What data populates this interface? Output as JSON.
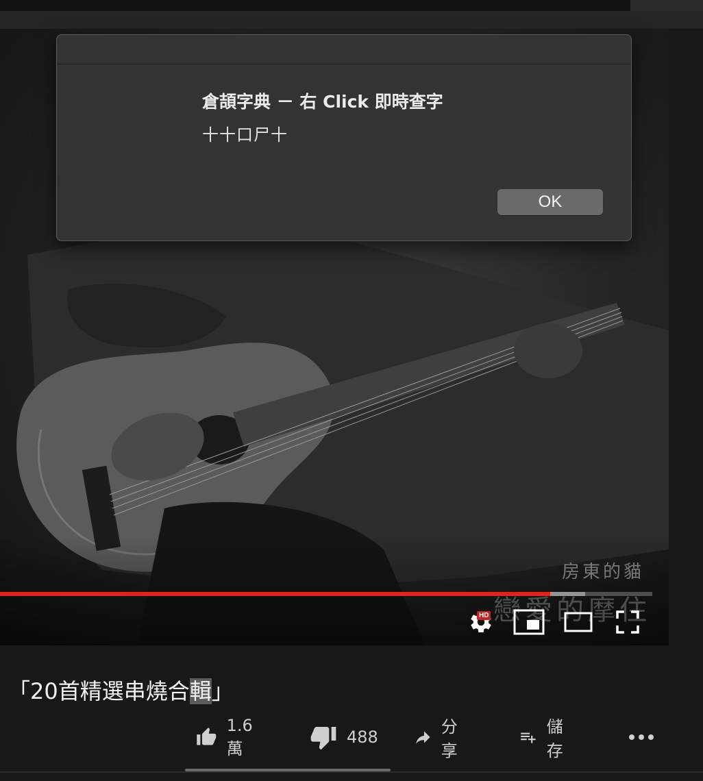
{
  "dialog": {
    "heading": "倉頡字典 － 右 Click 即時查字",
    "message": "十十口尸十",
    "ok_label": "OK"
  },
  "player": {
    "watermark_line1": "房東的貓",
    "watermark_line2": "戀愛的摩住",
    "progress_played": 0.844,
    "progress_buffered": 0.897,
    "hd_badge": "HD",
    "controls": [
      "settings-icon",
      "miniplayer-icon",
      "theater-mode-icon",
      "fullscreen-icon"
    ],
    "accent_color": "#e62117"
  },
  "video": {
    "title_prefix": "「20首精選串燒合",
    "title_highlight": "輯",
    "title_suffix": "」"
  },
  "actions": {
    "like_count": "1.6萬",
    "dislike_count": "488",
    "share_label": "分享",
    "save_label": "儲存"
  }
}
